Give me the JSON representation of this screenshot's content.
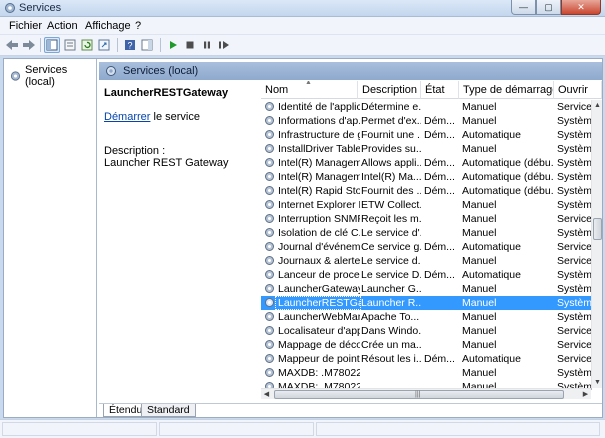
{
  "window": {
    "title": "Services"
  },
  "menu": {
    "items": [
      "Fichier",
      "Action",
      "Affichage",
      "?"
    ]
  },
  "tree": {
    "root_label": "Services (local)"
  },
  "panel": {
    "header_title": "Services (local)"
  },
  "description_pane": {
    "service_name": "LauncherRESTGateway",
    "start_link": "Démarrer",
    "start_suffix": " le service",
    "description_label": "Description :",
    "description_text": "Launcher REST Gateway"
  },
  "list": {
    "columns": [
      "Nom",
      "Description",
      "État",
      "Type de démarrage",
      "Ouvrir"
    ],
    "rows": [
      [
        "Identité de l'applic...",
        "Détermine e...",
        "",
        "Manuel",
        "Service"
      ],
      [
        "Informations d'ap...",
        "Permet d'ex...",
        "Dém...",
        "Manuel",
        "Systèm"
      ],
      [
        "Infrastructure de g...",
        "Fournit une ...",
        "Dém...",
        "Automatique",
        "Systèm"
      ],
      [
        "InstallDriver Table ...",
        "Provides su...",
        "",
        "Manuel",
        "Systèm"
      ],
      [
        "Intel(R) Managem...",
        "Allows appli...",
        "Dém...",
        "Automatique (débu...",
        "Systèm"
      ],
      [
        "Intel(R) Managem...",
        "Intel(R) Ma...",
        "Dém...",
        "Automatique (débu...",
        "Systèm"
      ],
      [
        "Intel(R) Rapid Stor...",
        "Fournit des ...",
        "Dém...",
        "Automatique (débu...",
        "Systèm"
      ],
      [
        "Internet Explorer E...",
        "ETW Collect...",
        "",
        "Manuel",
        "Systèm"
      ],
      [
        "Interruption SNMP",
        "Reçoit les m...",
        "",
        "Manuel",
        "Service"
      ],
      [
        "Isolation de clé C...",
        "Le service d'...",
        "",
        "Manuel",
        "Systèm"
      ],
      [
        "Journal d'événem...",
        "Ce service g...",
        "Dém...",
        "Automatique",
        "Service"
      ],
      [
        "Journaux & alertes...",
        "Le service d...",
        "",
        "Manuel",
        "Service"
      ],
      [
        "Lanceur de proces...",
        "Le service D...",
        "Dém...",
        "Automatique",
        "Systèm"
      ],
      [
        "LauncherGateway",
        "Launcher G...",
        "",
        "Manuel",
        "Systèm"
      ],
      [
        "LauncherRESTGat...",
        "Launcher R...",
        "",
        "Manuel",
        "Systèm"
      ],
      [
        "LauncherWebMan...",
        "Apache To...",
        "",
        "Manuel",
        "Systèm"
      ],
      [
        "Localisateur d'app...",
        "Dans Windo...",
        "",
        "Manuel",
        "Service"
      ],
      [
        "Mappage de déco...",
        "Crée un ma...",
        "",
        "Manuel",
        "Service"
      ],
      [
        "Mappeur de point...",
        "Résout les i...",
        "Dém...",
        "Automatique",
        "Service"
      ],
      [
        "MAXDB: .M780228",
        "",
        "",
        "Manuel",
        "Systèm"
      ],
      [
        "MAXDB: .M78022...",
        "",
        "",
        "Manuel",
        "Systèm"
      ]
    ],
    "selected_index": 14
  },
  "tabs": {
    "items": [
      "Étendu",
      "Standard"
    ]
  },
  "colors": {
    "selection": "#3399ff",
    "header_band": "#8ea9cd",
    "link": "#0645ad"
  }
}
